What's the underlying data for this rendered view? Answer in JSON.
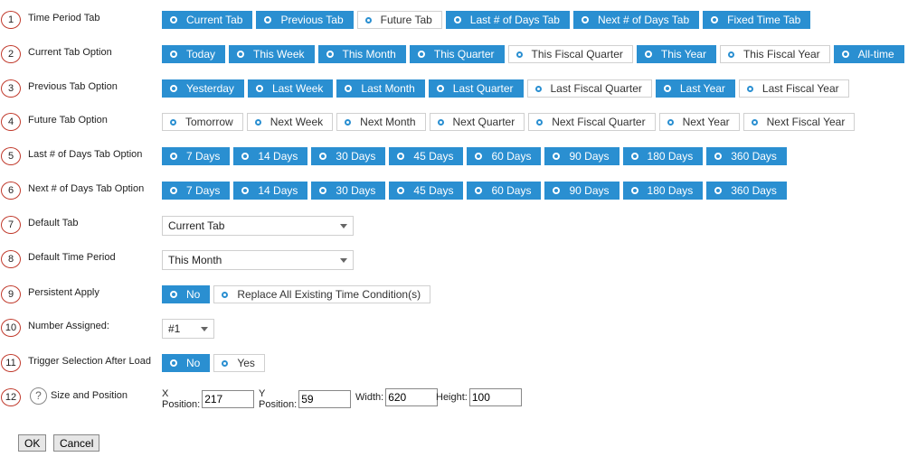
{
  "rows": [
    {
      "num": "1",
      "label": "Time Period Tab",
      "options": [
        {
          "label": "Current Tab",
          "selected": true
        },
        {
          "label": "Previous Tab",
          "selected": true
        },
        {
          "label": "Future Tab",
          "selected": false
        },
        {
          "label": "Last # of Days Tab",
          "selected": true
        },
        {
          "label": "Next # of Days Tab",
          "selected": true
        },
        {
          "label": "Fixed Time Tab",
          "selected": true
        }
      ]
    },
    {
      "num": "2",
      "label": "Current Tab Option",
      "options": [
        {
          "label": "Today",
          "selected": true
        },
        {
          "label": "This Week",
          "selected": true
        },
        {
          "label": "This Month",
          "selected": true
        },
        {
          "label": "This Quarter",
          "selected": true
        },
        {
          "label": "This Fiscal Quarter",
          "selected": false
        },
        {
          "label": "This Year",
          "selected": true
        },
        {
          "label": "This Fiscal Year",
          "selected": false
        },
        {
          "label": "All-time",
          "selected": true
        }
      ]
    },
    {
      "num": "3",
      "label": "Previous Tab Option",
      "options": [
        {
          "label": "Yesterday",
          "selected": true
        },
        {
          "label": "Last Week",
          "selected": true
        },
        {
          "label": "Last Month",
          "selected": true
        },
        {
          "label": "Last Quarter",
          "selected": true
        },
        {
          "label": "Last Fiscal Quarter",
          "selected": false
        },
        {
          "label": "Last Year",
          "selected": true
        },
        {
          "label": "Last Fiscal Year",
          "selected": false
        }
      ]
    },
    {
      "num": "4",
      "label": "Future Tab Option",
      "options": [
        {
          "label": "Tomorrow",
          "selected": false
        },
        {
          "label": "Next Week",
          "selected": false
        },
        {
          "label": "Next Month",
          "selected": false
        },
        {
          "label": "Next Quarter",
          "selected": false
        },
        {
          "label": "Next Fiscal Quarter",
          "selected": false
        },
        {
          "label": "Next Year",
          "selected": false
        },
        {
          "label": "Next Fiscal Year",
          "selected": false
        }
      ]
    },
    {
      "num": "5",
      "label": "Last # of Days Tab Option",
      "options": [
        {
          "label": "7 Days",
          "selected": true
        },
        {
          "label": "14 Days",
          "selected": true
        },
        {
          "label": "30 Days",
          "selected": true
        },
        {
          "label": "45 Days",
          "selected": true
        },
        {
          "label": "60 Days",
          "selected": true
        },
        {
          "label": "90 Days",
          "selected": true
        },
        {
          "label": "180 Days",
          "selected": true
        },
        {
          "label": "360 Days",
          "selected": true
        }
      ]
    },
    {
      "num": "6",
      "label": "Next # of Days Tab Option",
      "options": [
        {
          "label": "7 Days",
          "selected": true
        },
        {
          "label": "14 Days",
          "selected": true
        },
        {
          "label": "30 Days",
          "selected": true
        },
        {
          "label": "45 Days",
          "selected": true
        },
        {
          "label": "60 Days",
          "selected": true
        },
        {
          "label": "90 Days",
          "selected": true
        },
        {
          "label": "180 Days",
          "selected": true
        },
        {
          "label": "360 Days",
          "selected": true
        }
      ]
    }
  ],
  "default_tab": {
    "num": "7",
    "label": "Default Tab",
    "value": "Current Tab"
  },
  "default_period": {
    "num": "8",
    "label": "Default Time Period",
    "value": "This Month"
  },
  "persistent": {
    "num": "9",
    "label": "Persistent Apply",
    "options": [
      {
        "label": "No",
        "selected": true
      },
      {
        "label": "Replace All Existing Time Condition(s)",
        "selected": false
      }
    ]
  },
  "number_assigned": {
    "num": "10",
    "label": "Number Assigned:",
    "value": "#1"
  },
  "trigger": {
    "num": "11",
    "label": "Trigger Selection After Load",
    "options": [
      {
        "label": "No",
        "selected": true
      },
      {
        "label": "Yes",
        "selected": false
      }
    ]
  },
  "size_position": {
    "num": "12",
    "label": "Size and Position",
    "help": "?",
    "x_label": "X Position:",
    "x_value": "217",
    "y_label": "Y Position:",
    "y_value": "59",
    "w_label": "Width:",
    "w_value": "620",
    "h_label": "Height:",
    "h_value": "100"
  },
  "buttons": {
    "ok": "OK",
    "cancel": "Cancel"
  },
  "colors": {
    "selected": "#2a8fd1",
    "number_ring": "#c0392b"
  }
}
